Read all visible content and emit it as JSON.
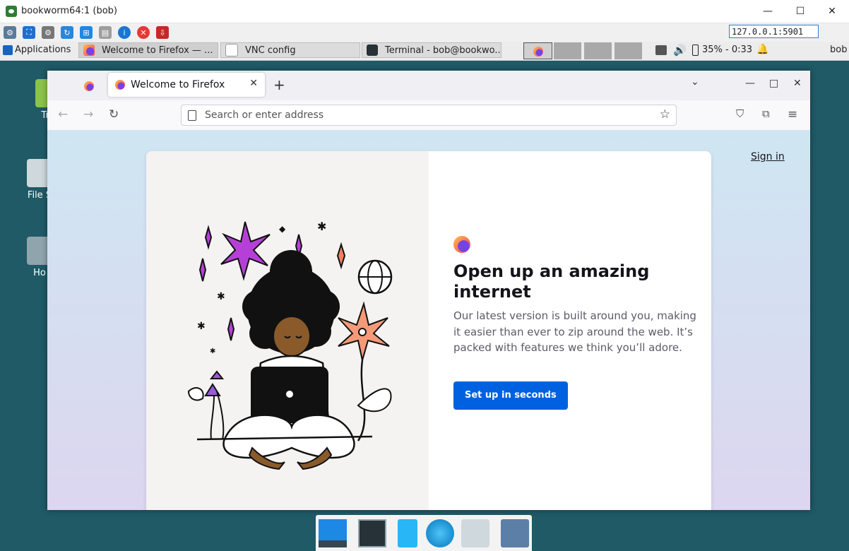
{
  "vnc_window": {
    "title": "bookworm64:1 (bob)",
    "host": "127.0.0.1:5901",
    "controls": {
      "minimize": "—",
      "maximize": "☐",
      "close": "✕"
    }
  },
  "panel": {
    "applications_label": "Applications",
    "tasks": [
      {
        "label": "Welcome to Firefox — ..."
      },
      {
        "label": "VNC config"
      },
      {
        "label": "Terminal - bob@bookwo..."
      }
    ],
    "battery_text": "35% - 0:33",
    "user": "bob"
  },
  "desktop": {
    "icons": [
      {
        "label": "Tra"
      },
      {
        "label": "File S"
      },
      {
        "label": "Ho"
      }
    ]
  },
  "firefox": {
    "tab_title": "Welcome to Firefox",
    "url_placeholder": "Search or enter address",
    "sign_in": "Sign in",
    "heading": "Open up an amazing internet",
    "body": "Our latest version is built around you, making it easier than ever to zip around the web. It’s packed with features we think you’ll adore.",
    "cta": "Set up in seconds"
  },
  "colors": {
    "cta_blue": "#0061e0",
    "desktop_bg": "#1f5a66",
    "content_gradient_top": "#cfe6f2",
    "content_gradient_bottom": "#dcd6f0"
  },
  "icons": [
    "vnc-app-icon",
    "options-icon",
    "fullscreen-icon",
    "settings-icon",
    "refresh-icon",
    "windows-icon",
    "clipboard-icon",
    "info-icon",
    "disconnect-icon",
    "transfer-icon",
    "xfce-logo-icon",
    "firefox-icon",
    "terminal-icon",
    "volume-icon",
    "battery-icon",
    "bell-icon",
    "back-icon",
    "forward-icon",
    "reload-icon",
    "pocket-icon",
    "extensions-icon",
    "menu-icon",
    "bookmark-star-icon"
  ]
}
